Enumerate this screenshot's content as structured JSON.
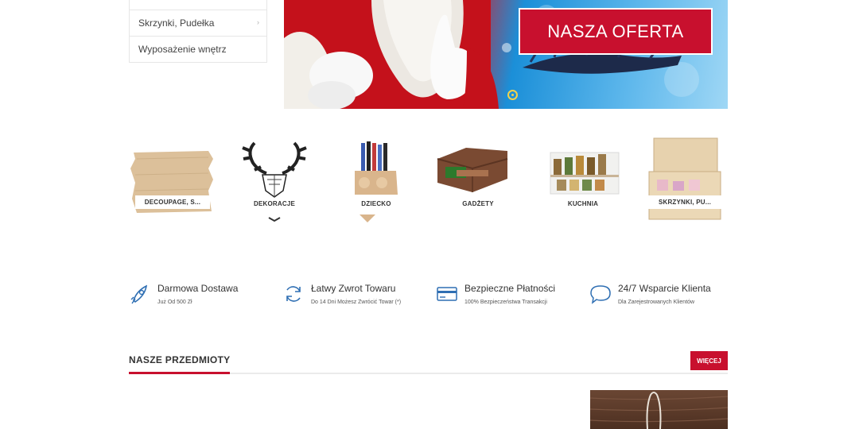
{
  "side_menu": {
    "items": [
      {
        "label": "",
        "chevron": ""
      },
      {
        "label": "Skrzynki, Pudełka",
        "chevron": "›"
      },
      {
        "label": "Wyposażenie wnętrz",
        "chevron": ""
      }
    ]
  },
  "hero": {
    "offer_label": "NASZA OFERTA"
  },
  "categories": [
    {
      "label": "DECOUPAGE, S...",
      "icon": "plywood-board-icon"
    },
    {
      "label": "DEKORACJE",
      "icon": "deer-head-icon"
    },
    {
      "label": "DZIECKO",
      "icon": "pencil-holder-icon"
    },
    {
      "label": "GADŻETY",
      "icon": "wooden-box-icon"
    },
    {
      "label": "KUCHNIA",
      "icon": "spice-rack-icon"
    },
    {
      "label": "SKRZYNKI, PU...",
      "icon": "wooden-chest-icon"
    }
  ],
  "features": [
    {
      "title": "Darmowa Dostawa",
      "subtitle": "Już Od 500 Zł",
      "icon": "rocket-icon"
    },
    {
      "title": "Łatwy Zwrot Towaru",
      "subtitle": "Do 14 Dni Możesz Zwrócić Towar (*)",
      "icon": "refresh-icon"
    },
    {
      "title": "Bezpieczne Płatności",
      "subtitle": "100% Bezpieczeństwa Transakcji",
      "icon": "credit-card-icon"
    },
    {
      "title": "24/7 Wsparcie Klienta",
      "subtitle": "Dla Zarejestrowanych Klientów",
      "icon": "chat-bubble-icon"
    }
  ],
  "section": {
    "title": "NASZE PRZEDMIOTY",
    "more_label": "WIĘCEJ"
  },
  "colors": {
    "accent": "#c8102e",
    "feature_icon": "#2f6fb3"
  }
}
